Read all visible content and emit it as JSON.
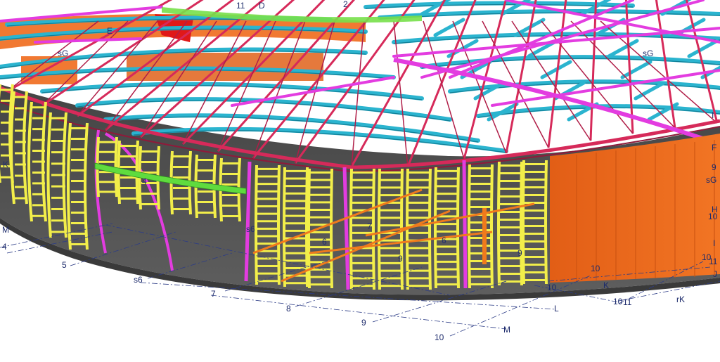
{
  "colors": {
    "background": "#ffffff",
    "cladding": "#f06a1e",
    "cladding_dark": "#c9500f",
    "floor": "#5c5c5c",
    "floor_dark": "#3d3d3d",
    "roof_beam": "#2bb4cf",
    "rafter": "#d62a5a",
    "pink_member": "#e33ce0",
    "green_member": "#5fdb3e",
    "facade_frame": "#f2ee4a",
    "gridline": "#2c3c86"
  },
  "grid_labels": {
    "a": "M",
    "b": "4",
    "c": "5",
    "d": "s6",
    "e": "7",
    "f": "8",
    "g": "9",
    "h": "10",
    "i": "L",
    "j": "M",
    "k": "10",
    "l": "10",
    "m": "K",
    "n": "10",
    "o": "11",
    "p": "rK",
    "q": "J",
    "r": "11",
    "s": "10",
    "t": "I",
    "u": "H",
    "v": "10",
    "w": "sG",
    "x": "9",
    "y": "F"
  },
  "member_marks": {
    "a": "sG",
    "b": "E",
    "c": "9",
    "d": "4",
    "e": "6",
    "f": "7",
    "g": "9",
    "h": "s6",
    "i": "sG",
    "j": "2",
    "k": "11",
    "l": "D",
    "m": "I",
    "n": "6",
    "o": "K"
  }
}
